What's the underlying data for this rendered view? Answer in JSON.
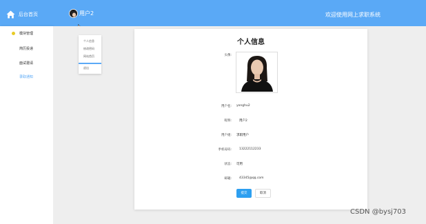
{
  "header": {
    "home_label": "后台首页",
    "username": "用户2",
    "welcome": "欢迎使用网上求职系统"
  },
  "sidebar": {
    "items": [
      {
        "label": "模块管理"
      },
      {
        "label": "简历投递"
      },
      {
        "label": "面试邀请"
      },
      {
        "label": "录取通知"
      }
    ]
  },
  "dropdown": {
    "items": [
      {
        "label": "个人信息"
      },
      {
        "label": "修改密码"
      },
      {
        "label": "网站首页"
      },
      {
        "label": "退出"
      }
    ]
  },
  "profile": {
    "title": "个人信息",
    "avatar_label": "头像:",
    "fields": [
      {
        "label": "用户名:",
        "value": "yonghu2"
      },
      {
        "label": "昵称:",
        "value": "用户2"
      },
      {
        "label": "用户组:",
        "value": "求职用户"
      },
      {
        "label": "手机号码:",
        "value": "13222112233"
      },
      {
        "label": "状态:",
        "value": "可用"
      },
      {
        "label": "邮箱:",
        "value": "43345@qq.com"
      }
    ],
    "save_label": "提交",
    "cancel_label": "取消"
  },
  "watermark": "CSDN @bysj703",
  "colors": {
    "header_bg": "#5aa9f6",
    "primary_button": "#2d9ff0",
    "active_nav": "#5aa9f6",
    "indicator_dot": "#e8cb25"
  }
}
